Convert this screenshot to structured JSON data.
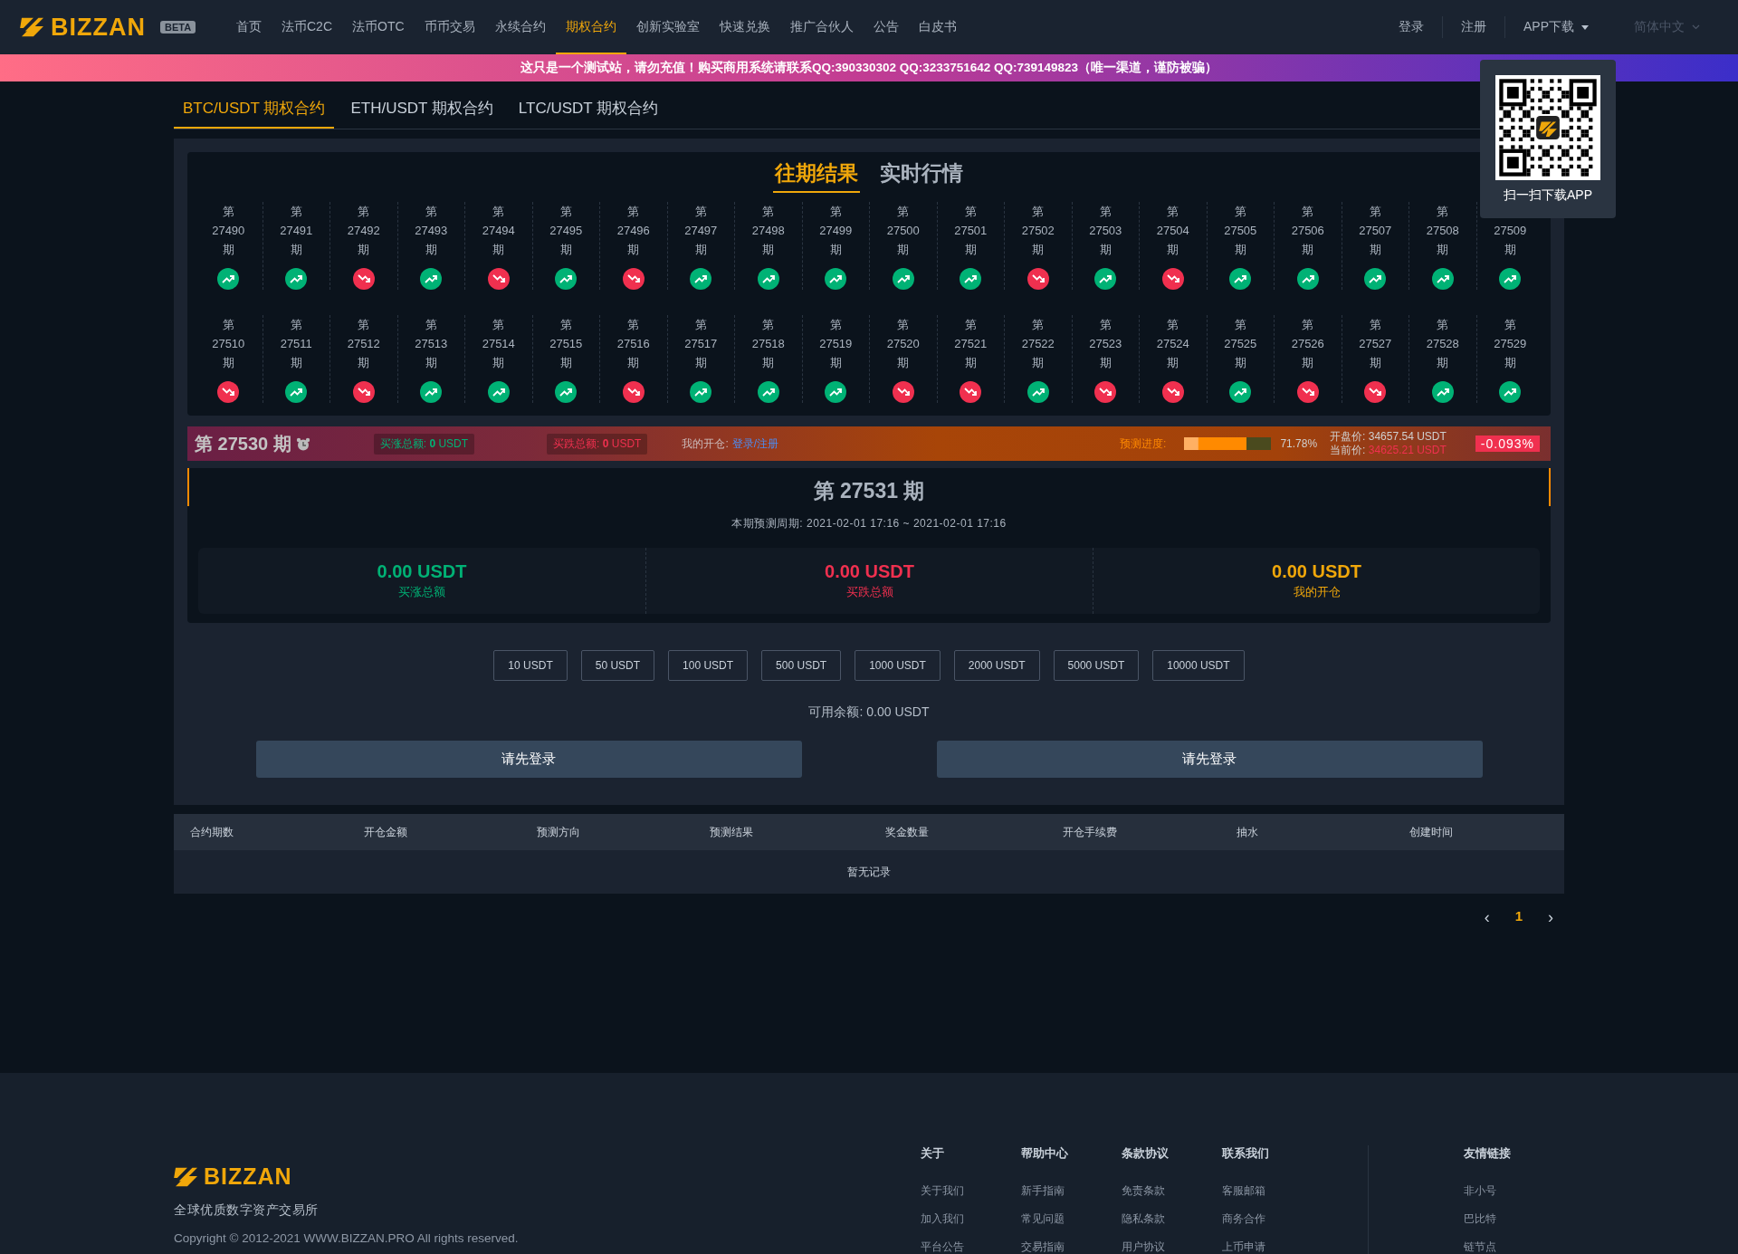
{
  "header": {
    "logo": "BIZZAN",
    "badge": "BETA",
    "nav": [
      {
        "label": "首页",
        "selected": false
      },
      {
        "label": "法币C2C",
        "selected": false
      },
      {
        "label": "法币OTC",
        "selected": false
      },
      {
        "label": "币币交易",
        "selected": false
      },
      {
        "label": "永续合约",
        "selected": false
      },
      {
        "label": "期权合约",
        "selected": true
      },
      {
        "label": "创新实验室",
        "selected": false
      },
      {
        "label": "快速兑换",
        "selected": false
      },
      {
        "label": "推广合伙人",
        "selected": false
      },
      {
        "label": "公告",
        "selected": false
      },
      {
        "label": "白皮书",
        "selected": false
      }
    ],
    "login": "登录",
    "register": "注册",
    "app_download": "APP下载",
    "language": "简体中文"
  },
  "banner": "这只是一个测试站，请勿充值！购买商用系统请联系QQ:390330302 QQ:3233751642 QQ:739149823（唯一渠道，谨防被骗）",
  "qr_popup": {
    "caption": "扫一扫下载APP"
  },
  "contract_tabs": [
    {
      "label": "BTC/USDT 期权合约",
      "selected": true
    },
    {
      "label": "ETH/USDT 期权合约",
      "selected": false
    },
    {
      "label": "LTC/USDT 期权合约",
      "selected": false
    }
  ],
  "section_tabs": [
    {
      "label": "往期结果",
      "selected": true
    },
    {
      "label": "实时行情",
      "selected": false
    }
  ],
  "periods": [
    {
      "prefix": "第",
      "number": "27490",
      "suffix": "期",
      "kind": "up"
    },
    {
      "prefix": "第",
      "number": "27491",
      "suffix": "期",
      "kind": "up"
    },
    {
      "prefix": "第",
      "number": "27492",
      "suffix": "期",
      "kind": "down"
    },
    {
      "prefix": "第",
      "number": "27493",
      "suffix": "期",
      "kind": "up"
    },
    {
      "prefix": "第",
      "number": "27494",
      "suffix": "期",
      "kind": "down"
    },
    {
      "prefix": "第",
      "number": "27495",
      "suffix": "期",
      "kind": "up"
    },
    {
      "prefix": "第",
      "number": "27496",
      "suffix": "期",
      "kind": "down"
    },
    {
      "prefix": "第",
      "number": "27497",
      "suffix": "期",
      "kind": "up"
    },
    {
      "prefix": "第",
      "number": "27498",
      "suffix": "期",
      "kind": "up"
    },
    {
      "prefix": "第",
      "number": "27499",
      "suffix": "期",
      "kind": "up"
    },
    {
      "prefix": "第",
      "number": "27500",
      "suffix": "期",
      "kind": "up"
    },
    {
      "prefix": "第",
      "number": "27501",
      "suffix": "期",
      "kind": "up"
    },
    {
      "prefix": "第",
      "number": "27502",
      "suffix": "期",
      "kind": "down"
    },
    {
      "prefix": "第",
      "number": "27503",
      "suffix": "期",
      "kind": "up"
    },
    {
      "prefix": "第",
      "number": "27504",
      "suffix": "期",
      "kind": "down"
    },
    {
      "prefix": "第",
      "number": "27505",
      "suffix": "期",
      "kind": "up"
    },
    {
      "prefix": "第",
      "number": "27506",
      "suffix": "期",
      "kind": "up"
    },
    {
      "prefix": "第",
      "number": "27507",
      "suffix": "期",
      "kind": "up"
    },
    {
      "prefix": "第",
      "number": "27508",
      "suffix": "期",
      "kind": "up"
    },
    {
      "number": "27509",
      "suffix": "期",
      "kind": "up"
    },
    {
      "prefix": "第",
      "number": "27510",
      "suffix": "期",
      "kind": "down"
    },
    {
      "prefix": "第",
      "number": "27511",
      "suffix": "期",
      "kind": "up"
    },
    {
      "prefix": "第",
      "number": "27512",
      "suffix": "期",
      "kind": "down"
    },
    {
      "prefix": "第",
      "number": "27513",
      "suffix": "期",
      "kind": "up"
    },
    {
      "prefix": "第",
      "number": "27514",
      "suffix": "期",
      "kind": "up"
    },
    {
      "prefix": "第",
      "number": "27515",
      "suffix": "期",
      "kind": "up"
    },
    {
      "prefix": "第",
      "number": "27516",
      "suffix": "期",
      "kind": "down"
    },
    {
      "prefix": "第",
      "number": "27517",
      "suffix": "期",
      "kind": "up"
    },
    {
      "prefix": "第",
      "number": "27518",
      "suffix": "期",
      "kind": "up"
    },
    {
      "prefix": "第",
      "number": "27519",
      "suffix": "期",
      "kind": "up"
    },
    {
      "prefix": "第",
      "number": "27520",
      "suffix": "期",
      "kind": "down"
    },
    {
      "prefix": "第",
      "number": "27521",
      "suffix": "期",
      "kind": "down"
    },
    {
      "prefix": "第",
      "number": "27522",
      "suffix": "期",
      "kind": "up"
    },
    {
      "prefix": "第",
      "number": "27523",
      "suffix": "期",
      "kind": "down"
    },
    {
      "prefix": "第",
      "number": "27524",
      "suffix": "期",
      "kind": "down"
    },
    {
      "prefix": "第",
      "number": "27525",
      "suffix": "期",
      "kind": "up"
    },
    {
      "prefix": "第",
      "number": "27526",
      "suffix": "期",
      "kind": "down"
    },
    {
      "prefix": "第",
      "number": "27527",
      "suffix": "期",
      "kind": "down"
    },
    {
      "prefix": "第",
      "number": "27528",
      "suffix": "期",
      "kind": "up"
    },
    {
      "prefix": "第",
      "number": "27529",
      "suffix": "期",
      "kind": "up"
    }
  ],
  "current": {
    "title": "第 27530 期",
    "buy_up": "买涨总额: **0** USDT",
    "buy_down": "买跌总额: **0** USDT",
    "my_position_label": "我的开仓:",
    "my_position_link": "登录/注册",
    "progress_label": "预测进度:",
    "level": 0.7178,
    "progress_text": "71.78%",
    "open_price_label": "开盘价:",
    "open_price": "34657.54 USDT",
    "current_price_label": "当前价:",
    "current_price": "34625.21 USDT",
    "change": "-0.093%"
  },
  "next": {
    "title": "第 27531 期",
    "period": "本期预测周期: 2021-02-01 17:16 ~ 2021-02-01 17:16",
    "stats": [
      {
        "kind": "up",
        "value": "0.00 USDT",
        "label": "买涨总额"
      },
      {
        "kind": "down",
        "value": "0.00 USDT",
        "label": "买跌总额"
      },
      {
        "kind": "mine",
        "value": "0.00 USDT",
        "label": "我的开仓"
      }
    ]
  },
  "amounts": [
    "10 USDT",
    "50 USDT",
    "100 USDT",
    "500 USDT",
    "1000 USDT",
    "2000 USDT",
    "5000 USDT",
    "10000 USDT"
  ],
  "balance": "可用余额: 0.00 USDT",
  "actions": [
    "请先登录",
    "请先登录"
  ],
  "table": {
    "columns": [
      "合约期数",
      "开仓金额",
      "预测方向",
      "预测结果",
      "奖金数量",
      "开仓手续费",
      "抽水",
      "创建时间"
    ],
    "empty": "暂无记录"
  },
  "pagination": {
    "prev": "‹",
    "pages": [
      {
        "label": "1",
        "selected": true
      }
    ],
    "next": "›"
  },
  "footer": {
    "logo": "BIZZAN",
    "tagline": "全球优质数字资产交易所",
    "copyright": "Copyright © 2012-2021 WWW.BIZZAN.PRO All rights reserved.",
    "columns": [
      {
        "title": "关于",
        "links": [
          "关于我们",
          "加入我们",
          "平台公告"
        ]
      },
      {
        "title": "帮助中心",
        "links": [
          "新手指南",
          "常见问题",
          "交易指南"
        ]
      },
      {
        "title": "条款协议",
        "links": [
          "免责条款",
          "隐私条款",
          "用户协议"
        ]
      },
      {
        "title": "联系我们",
        "links": [
          "客服邮箱",
          "商务合作",
          "上币申请"
        ]
      }
    ],
    "friends": {
      "title": "友情链接",
      "links": [
        "非小号",
        "巴比特",
        "链节点"
      ]
    }
  }
}
